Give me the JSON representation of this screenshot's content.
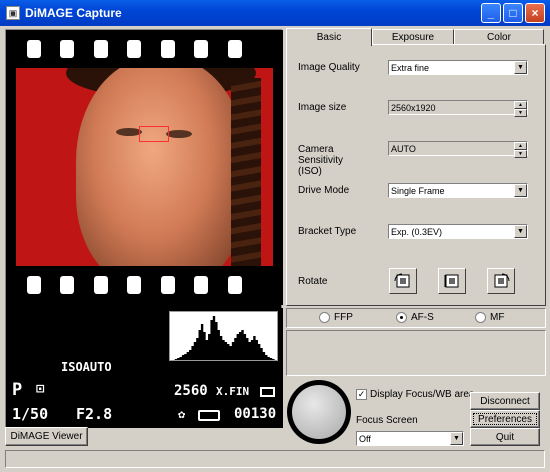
{
  "window": {
    "title": "DiMAGE Capture",
    "minimize": "_",
    "maximize": "□",
    "close": "×"
  },
  "status_display": {
    "iso": "ISOAUTO",
    "mode": "P",
    "metering": "⊡",
    "resolution": "2560",
    "quality": "X.FIN",
    "shutter": "1/50",
    "aperture": "F2.8",
    "frame_count": "00130"
  },
  "histogram": {
    "bins": [
      0,
      0,
      1,
      2,
      3,
      5,
      6,
      8,
      10,
      14,
      18,
      22,
      30,
      36,
      28,
      20,
      26,
      40,
      44,
      38,
      30,
      24,
      20,
      18,
      16,
      14,
      18,
      22,
      26,
      28,
      30,
      26,
      22,
      18,
      20,
      24,
      20,
      16,
      12,
      8,
      5,
      3,
      2,
      1,
      0
    ]
  },
  "viewer_button": "DiMAGE Viewer",
  "tabs": [
    {
      "label": "Basic",
      "active": true
    },
    {
      "label": "Exposure"
    },
    {
      "label": "Color"
    }
  ],
  "basic": {
    "image_quality": {
      "label": "Image Quality",
      "value": "Extra fine"
    },
    "image_size": {
      "label": "Image size",
      "value": "2560x1920"
    },
    "sensitivity": {
      "label_1": "Camera",
      "label_2": "Sensitivity",
      "label_3": "(ISO)",
      "value": "AUTO"
    },
    "drive_mode": {
      "label": "Drive Mode",
      "value": "Single Frame"
    },
    "bracket_type": {
      "label": "Bracket Type",
      "value": "Exp. (0.3EV)"
    },
    "rotate": {
      "label": "Rotate"
    }
  },
  "af_modes": [
    {
      "label": "FFP",
      "selected": false
    },
    {
      "label": "AF-S",
      "selected": true
    },
    {
      "label": "MF",
      "selected": false
    }
  ],
  "display_focus": {
    "label": "Display Focus/WB area.",
    "checked": true,
    "mark": "✓"
  },
  "focus_screen": {
    "label": "Focus Screen",
    "value": "Off"
  },
  "buttons": {
    "disconnect": "Disconnect",
    "preferences": "Preferences",
    "quit": "Quit"
  },
  "icons": {
    "arrow_down": "▼",
    "spin_up": "▲",
    "spin_down": "▼"
  }
}
